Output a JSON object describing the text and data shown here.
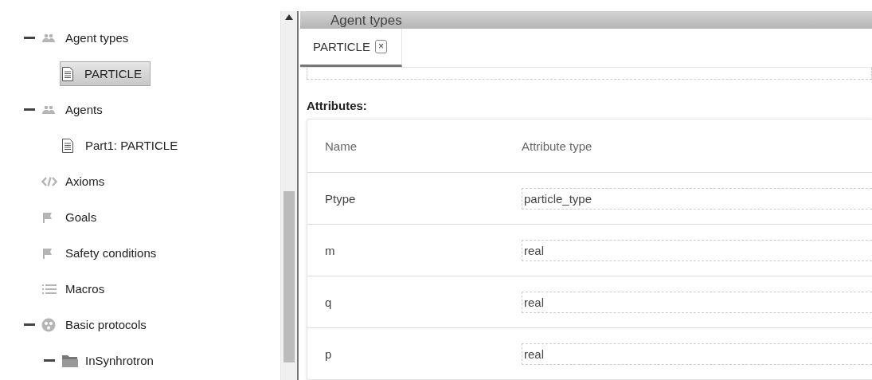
{
  "tree": [
    {
      "label": "Agent types",
      "kind": "agent-group",
      "expanded": true,
      "children": [
        {
          "label": "PARTICLE",
          "kind": "document",
          "selected": true
        }
      ]
    },
    {
      "label": "Agents",
      "kind": "agent-group",
      "expanded": true,
      "children": [
        {
          "label": "Part1: PARTICLE",
          "kind": "document",
          "selected": false
        }
      ]
    },
    {
      "label": "Axioms",
      "kind": "axioms"
    },
    {
      "label": "Goals",
      "kind": "flag"
    },
    {
      "label": "Safety conditions",
      "kind": "flag"
    },
    {
      "label": "Macros",
      "kind": "list"
    },
    {
      "label": "Basic protocols",
      "kind": "protocol",
      "expanded": true,
      "children": [
        {
          "label": "InSynhrotron",
          "kind": "folder",
          "expanded": true
        }
      ]
    }
  ],
  "panel": {
    "title": "Agent types",
    "tabs": [
      {
        "label": "PARTICLE",
        "close": "×",
        "selected": true
      }
    ],
    "section_title": "Attributes:",
    "table": {
      "columns": [
        "Name",
        "Attribute type"
      ],
      "rows": [
        {
          "name": "Ptype",
          "type": "particle_type"
        },
        {
          "name": "m",
          "type": "real"
        },
        {
          "name": "q",
          "type": "real"
        },
        {
          "name": "p",
          "type": "real"
        }
      ]
    }
  }
}
